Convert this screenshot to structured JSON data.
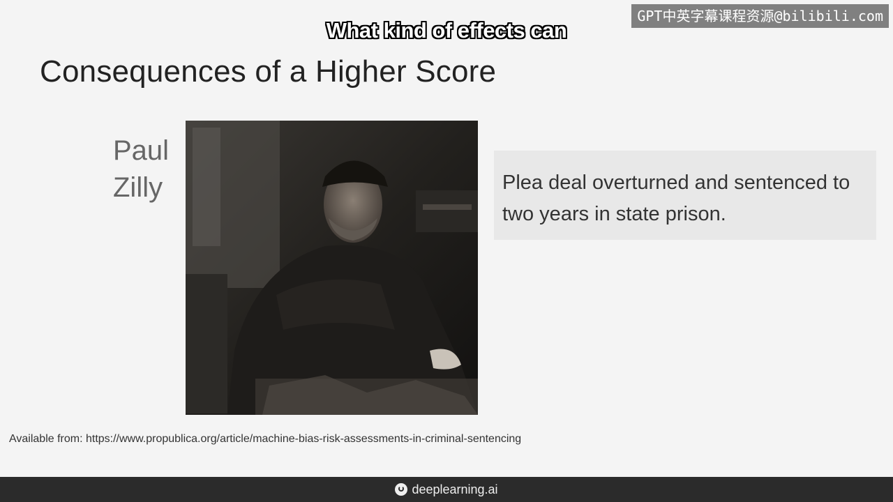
{
  "slide": {
    "title": "Consequences of a Higher Score",
    "person_name_first": "Paul",
    "person_name_last": "Zilly",
    "quote": "Plea deal overturned and sentenced to two years in state prison.",
    "source": "Available from: https://www.propublica.org/article/machine-bias-risk-assessments-in-criminal-sentencing"
  },
  "subtitle": "What kind of effects can",
  "watermark": "GPT中英字幕课程资源@bilibili.com",
  "footer": {
    "brand": "deeplearning.ai",
    "icon": "deeplearning-logo-icon"
  },
  "colors": {
    "slide_bg": "#f4f4f4",
    "quote_bg": "#e8e8e8",
    "footer_bg": "#2b2b2b"
  }
}
